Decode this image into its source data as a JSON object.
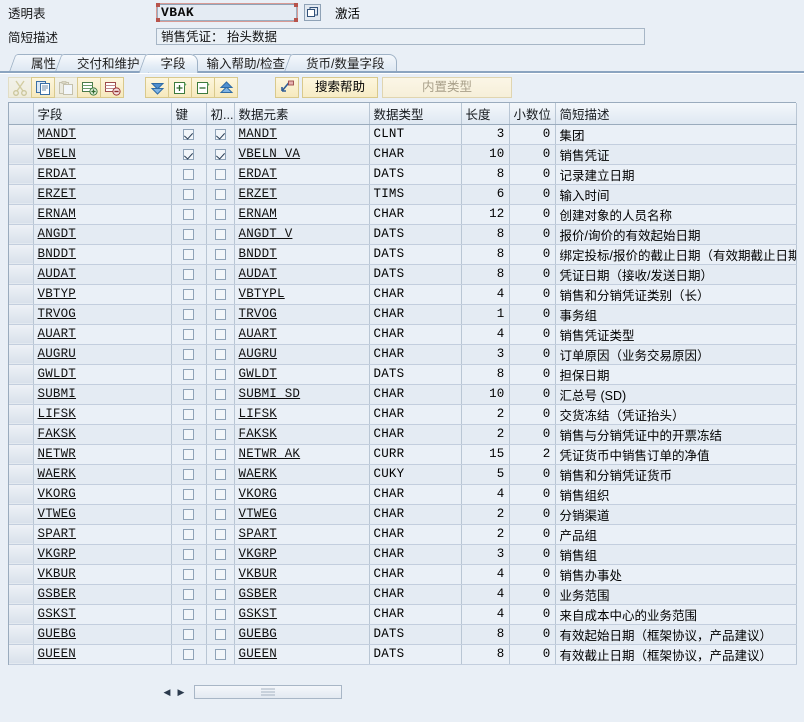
{
  "header": {
    "table_type_label": "透明表",
    "table_name": "VBAK",
    "table_name_placeholder": "",
    "activation_status": "激活",
    "short_desc_label": "简短描述",
    "short_desc_value": "销售凭证：  抬头数据",
    "matchcode_icon": "matchcode-icon"
  },
  "tabs": [
    {
      "label": "属性",
      "active": false
    },
    {
      "label": "交付和维护",
      "active": false
    },
    {
      "label": "字段",
      "active": true
    },
    {
      "label": "输入帮助/检查",
      "active": false
    },
    {
      "label": "货币/数量字段",
      "active": false
    }
  ],
  "toolbar": {
    "buttons": [
      {
        "name": "cut-icon",
        "title": "剪切",
        "enabled": false
      },
      {
        "name": "copy-icon",
        "title": "复制",
        "enabled": true
      },
      {
        "name": "paste-icon",
        "title": "粘贴",
        "enabled": false
      },
      {
        "name": "insert-row-icon",
        "title": "插入行",
        "enabled": true
      },
      {
        "name": "delete-row-icon",
        "title": "删除行",
        "enabled": true
      },
      {
        "name": "collapse-all-icon",
        "title": "折叠",
        "enabled": true
      },
      {
        "name": "expand-row-icon",
        "title": "扩展",
        "enabled": true
      },
      {
        "name": "collapse-row-icon",
        "title": "收起",
        "enabled": true
      },
      {
        "name": "expand-all-icon",
        "title": "展开",
        "enabled": true
      }
    ],
    "predefined_nav_icon": "drill-down-icon",
    "search_help_label": "搜索帮助",
    "builtin_type_label": "内置类型"
  },
  "grid": {
    "columns": [
      {
        "key": "sel",
        "label": ""
      },
      {
        "key": "field",
        "label": "字段"
      },
      {
        "key": "key",
        "label": "键"
      },
      {
        "key": "init",
        "label": "初..."
      },
      {
        "key": "dataelement",
        "label": "数据元素"
      },
      {
        "key": "datatype",
        "label": "数据类型"
      },
      {
        "key": "length",
        "label": "长度"
      },
      {
        "key": "decimals",
        "label": "小数位"
      },
      {
        "key": "shortdesc",
        "label": "简短描述"
      }
    ],
    "rows": [
      {
        "field": "MANDT",
        "key": true,
        "init": true,
        "dataelement": "MANDT",
        "datatype": "CLNT",
        "length": "3",
        "decimals": "0",
        "shortdesc": "集团"
      },
      {
        "field": "VBELN",
        "key": true,
        "init": true,
        "dataelement": "VBELN_VA",
        "datatype": "CHAR",
        "length": "10",
        "decimals": "0",
        "shortdesc": "销售凭证"
      },
      {
        "field": "ERDAT",
        "key": false,
        "init": false,
        "dataelement": "ERDAT",
        "datatype": "DATS",
        "length": "8",
        "decimals": "0",
        "shortdesc": "记录建立日期"
      },
      {
        "field": "ERZET",
        "key": false,
        "init": false,
        "dataelement": "ERZET",
        "datatype": "TIMS",
        "length": "6",
        "decimals": "0",
        "shortdesc": "输入时间"
      },
      {
        "field": "ERNAM",
        "key": false,
        "init": false,
        "dataelement": "ERNAM",
        "datatype": "CHAR",
        "length": "12",
        "decimals": "0",
        "shortdesc": "创建对象的人员名称"
      },
      {
        "field": "ANGDT",
        "key": false,
        "init": false,
        "dataelement": "ANGDT_V",
        "datatype": "DATS",
        "length": "8",
        "decimals": "0",
        "shortdesc": "报价/询价的有效起始日期"
      },
      {
        "field": "BNDDT",
        "key": false,
        "init": false,
        "dataelement": "BNDDT",
        "datatype": "DATS",
        "length": "8",
        "decimals": "0",
        "shortdesc": "绑定投标/报价的截止日期（有效期截止日期）"
      },
      {
        "field": "AUDAT",
        "key": false,
        "init": false,
        "dataelement": "AUDAT",
        "datatype": "DATS",
        "length": "8",
        "decimals": "0",
        "shortdesc": "凭证日期（接收/发送日期）"
      },
      {
        "field": "VBTYP",
        "key": false,
        "init": false,
        "dataelement": "VBTYPL",
        "datatype": "CHAR",
        "length": "4",
        "decimals": "0",
        "shortdesc": "销售和分销凭证类别（长）"
      },
      {
        "field": "TRVOG",
        "key": false,
        "init": false,
        "dataelement": "TRVOG",
        "datatype": "CHAR",
        "length": "1",
        "decimals": "0",
        "shortdesc": "事务组"
      },
      {
        "field": "AUART",
        "key": false,
        "init": false,
        "dataelement": "AUART",
        "datatype": "CHAR",
        "length": "4",
        "decimals": "0",
        "shortdesc": "销售凭证类型"
      },
      {
        "field": "AUGRU",
        "key": false,
        "init": false,
        "dataelement": "AUGRU",
        "datatype": "CHAR",
        "length": "3",
        "decimals": "0",
        "shortdesc": "订单原因（业务交易原因）"
      },
      {
        "field": "GWLDT",
        "key": false,
        "init": false,
        "dataelement": "GWLDT",
        "datatype": "DATS",
        "length": "8",
        "decimals": "0",
        "shortdesc": "担保日期"
      },
      {
        "field": "SUBMI",
        "key": false,
        "init": false,
        "dataelement": "SUBMI_SD",
        "datatype": "CHAR",
        "length": "10",
        "decimals": "0",
        "shortdesc": "汇总号 (SD)"
      },
      {
        "field": "LIFSK",
        "key": false,
        "init": false,
        "dataelement": "LIFSK",
        "datatype": "CHAR",
        "length": "2",
        "decimals": "0",
        "shortdesc": "交货冻结（凭证抬头）"
      },
      {
        "field": "FAKSK",
        "key": false,
        "init": false,
        "dataelement": "FAKSK",
        "datatype": "CHAR",
        "length": "2",
        "decimals": "0",
        "shortdesc": "销售与分销凭证中的开票冻结"
      },
      {
        "field": "NETWR",
        "key": false,
        "init": false,
        "dataelement": "NETWR_AK",
        "datatype": "CURR",
        "length": "15",
        "decimals": "2",
        "shortdesc": "凭证货币中销售订单的净值"
      },
      {
        "field": "WAERK",
        "key": false,
        "init": false,
        "dataelement": "WAERK",
        "datatype": "CUKY",
        "length": "5",
        "decimals": "0",
        "shortdesc": "销售和分销凭证货币"
      },
      {
        "field": "VKORG",
        "key": false,
        "init": false,
        "dataelement": "VKORG",
        "datatype": "CHAR",
        "length": "4",
        "decimals": "0",
        "shortdesc": "销售组织"
      },
      {
        "field": "VTWEG",
        "key": false,
        "init": false,
        "dataelement": "VTWEG",
        "datatype": "CHAR",
        "length": "2",
        "decimals": "0",
        "shortdesc": "分销渠道"
      },
      {
        "field": "SPART",
        "key": false,
        "init": false,
        "dataelement": "SPART",
        "datatype": "CHAR",
        "length": "2",
        "decimals": "0",
        "shortdesc": "产品组"
      },
      {
        "field": "VKGRP",
        "key": false,
        "init": false,
        "dataelement": "VKGRP",
        "datatype": "CHAR",
        "length": "3",
        "decimals": "0",
        "shortdesc": "销售组"
      },
      {
        "field": "VKBUR",
        "key": false,
        "init": false,
        "dataelement": "VKBUR",
        "datatype": "CHAR",
        "length": "4",
        "decimals": "0",
        "shortdesc": "销售办事处"
      },
      {
        "field": "GSBER",
        "key": false,
        "init": false,
        "dataelement": "GSBER",
        "datatype": "CHAR",
        "length": "4",
        "decimals": "0",
        "shortdesc": "业务范围"
      },
      {
        "field": "GSKST",
        "key": false,
        "init": false,
        "dataelement": "GSKST",
        "datatype": "CHAR",
        "length": "4",
        "decimals": "0",
        "shortdesc": "来自成本中心的业务范围"
      },
      {
        "field": "GUEBG",
        "key": false,
        "init": false,
        "dataelement": "GUEBG",
        "datatype": "DATS",
        "length": "8",
        "decimals": "0",
        "shortdesc": "有效起始日期（框架协议，产品建议）"
      },
      {
        "field": "GUEEN",
        "key": false,
        "init": false,
        "dataelement": "GUEEN",
        "datatype": "DATS",
        "length": "8",
        "decimals": "0",
        "shortdesc": "有效截止日期（框架协议，产品建议）"
      }
    ]
  },
  "scrollbar": {
    "left_arrow_icon": "arrow-left-icon",
    "right_arrow_icon": "arrow-right-icon",
    "thumb_icon": "scroll-grip-icon"
  }
}
